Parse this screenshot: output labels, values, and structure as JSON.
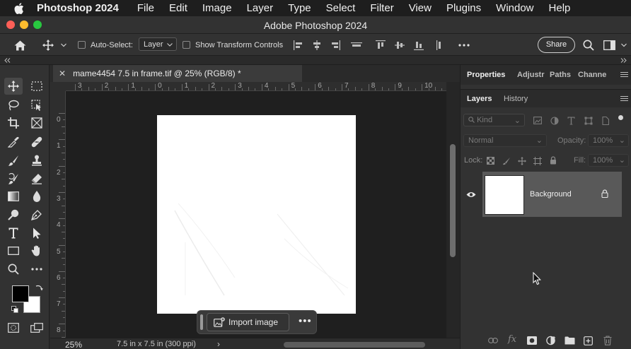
{
  "menubar": {
    "app_name": "Photoshop 2024",
    "items": [
      "File",
      "Edit",
      "Image",
      "Layer",
      "Type",
      "Select",
      "Filter",
      "View",
      "Plugins",
      "Window",
      "Help"
    ]
  },
  "window": {
    "title": "Adobe Photoshop 2024",
    "traffic_colors": [
      "#ff5f57",
      "#febc2e",
      "#28c840"
    ]
  },
  "options_bar": {
    "auto_select_label": "Auto-Select:",
    "auto_select_checked": false,
    "auto_select_target": "Layer",
    "transform_controls_label": "Show Transform Controls",
    "transform_controls_checked": false,
    "share_label": "Share"
  },
  "document": {
    "tab_title": "mame4454 7.5 in frame.tif @ 25% (RGB/8) *",
    "zoom": "25%",
    "dimensions": "7.5 in x 7.5 in (300 ppi)",
    "rulers": {
      "top": [
        "3",
        "2",
        "1",
        "0",
        "1",
        "2",
        "3",
        "4",
        "5",
        "6",
        "7",
        "8",
        "9",
        "10"
      ],
      "left": [
        "0",
        "1",
        "2",
        "3",
        "4",
        "5",
        "6",
        "7",
        "8"
      ]
    }
  },
  "taskbar": {
    "import_label": "Import image",
    "more_label": "•••"
  },
  "panels": {
    "top_tabs": [
      "Properties",
      "Adjustr",
      "Paths",
      "Channe"
    ],
    "layer_tabs": [
      "Layers",
      "History"
    ],
    "kind_placeholder": "Kind",
    "blend_mode": "Normal",
    "opacity_label": "Opacity:",
    "opacity_value": "100%",
    "lock_label": "Lock:",
    "fill_label": "Fill:",
    "fill_value": "100%",
    "layers": [
      {
        "name": "Background",
        "visible": true,
        "locked": true
      }
    ]
  },
  "colors": {
    "foreground": "#000000",
    "background": "#ffffff",
    "panel_bg": "#323232",
    "canvas_bg": "#1f1f1f",
    "selected_layer": "#595959"
  }
}
